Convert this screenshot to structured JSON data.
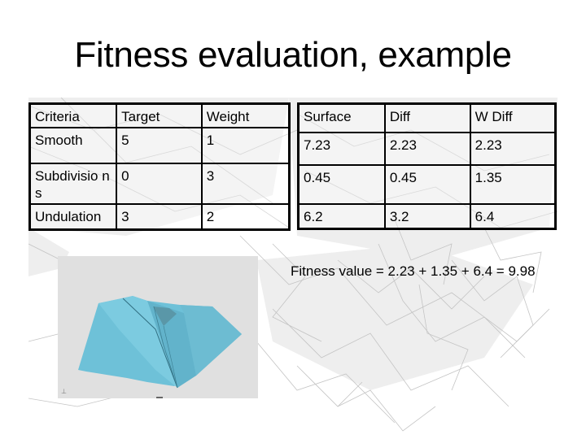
{
  "slide": {
    "title": "Fitness evaluation, example"
  },
  "left_table": {
    "headers": [
      "Criteria",
      "Target",
      "Weight"
    ],
    "rows": [
      [
        "Smooth",
        "5",
        "1"
      ],
      [
        "Subdivisions",
        "0",
        "3"
      ],
      [
        "Undulation",
        "3",
        "2"
      ]
    ],
    "display_labels": [
      "Smooth",
      "Subdivisio ns",
      "Undulation"
    ]
  },
  "right_table": {
    "headers": [
      "Surface",
      "Diff",
      "W Diff"
    ],
    "rows": [
      [
        "7.23",
        "2.23",
        "2.23"
      ],
      [
        "0.45",
        "0.45",
        "1.35"
      ],
      [
        "6.2",
        "3.2",
        "6.4"
      ]
    ]
  },
  "fitness_formula": "Fitness value = 2.23 + 1.35 + 6.4 = 9.98",
  "render_image": {
    "description": "3D rendered blue folded surface",
    "surface_color": "#6ec1d8",
    "background_color": "#e0e0e0"
  },
  "colors": {
    "text": "#000000",
    "background": "#ffffff",
    "wireframe": "#c8c8c8"
  }
}
